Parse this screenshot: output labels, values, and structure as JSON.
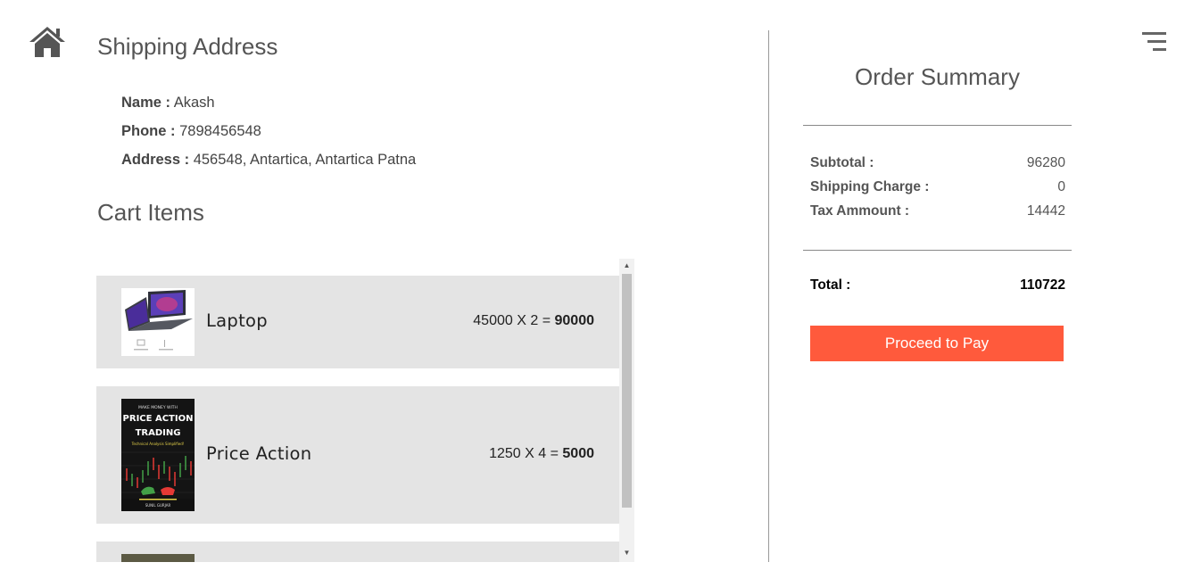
{
  "nav": {
    "home_icon": "home-icon",
    "menu_icon": "menu-icon"
  },
  "shipping": {
    "title": "Shipping Address",
    "name_label": "Name :",
    "name": "Akash",
    "phone_label": "Phone :",
    "phone": "7898456548",
    "address_label": "Address :",
    "address": "456548, Antartica, Antartica Patna"
  },
  "cart": {
    "title": "Cart Items",
    "items": [
      {
        "name": "Laptop",
        "price": "45000",
        "x": "X",
        "qty": "2",
        "eq": "=",
        "total": "90000"
      },
      {
        "name": "Price Action",
        "price": "1250",
        "x": "X",
        "qty": "4",
        "eq": "=",
        "total": "5000"
      },
      {
        "name": "",
        "price": "",
        "qty": "",
        "total": ""
      }
    ],
    "book_cover": {
      "line1": "MAKE MONEY WITH",
      "line2": "PRICE ACTION",
      "line3": "TRADING",
      "line4": "Technical Analysis Simplified!",
      "author": "SUNIL GURJAR"
    }
  },
  "summary": {
    "title": "Order Summary",
    "subtotal_label": "Subtotal :",
    "subtotal": "96280",
    "shipping_label": "Shipping Charge :",
    "shipping": "0",
    "tax_label": "Tax Ammount :",
    "tax": "14442",
    "total_label": "Total :",
    "total": "110722",
    "pay_button": "Proceed to Pay"
  },
  "colors": {
    "pay_button": "#ff5a3c",
    "cart_item_bg": "#e4e4e4",
    "text": "#444444"
  }
}
